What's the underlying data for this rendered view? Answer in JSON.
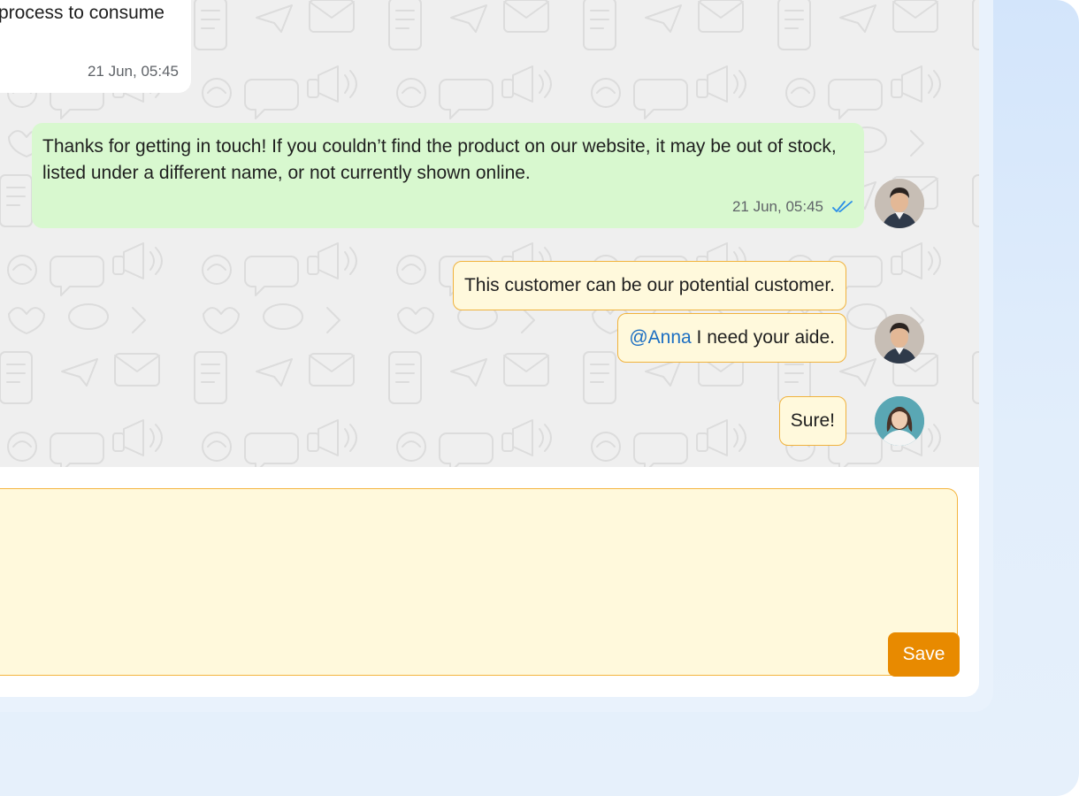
{
  "messages": {
    "incoming_fragment": {
      "text": "process to consume",
      "time": "21 Jun, 05:45"
    },
    "outgoing_reply": {
      "text": "Thanks for getting in touch! If you couldn’t find the product on our website, it may be out of stock, listed under a different name, or not currently shown online.",
      "time": "21 Jun, 05:45",
      "status_icon": "double-check-icon",
      "status_color": "#2a8ee8"
    },
    "internal_notes": [
      {
        "text": "This customer can be our potential customer."
      },
      {
        "mention": "@Anna",
        "text": " I need your aide."
      },
      {
        "text": "Sure!"
      }
    ]
  },
  "composer": {
    "save_label": "Save"
  },
  "colors": {
    "outgoing_bubble": "#d8f8cf",
    "note_bubble": "#fff9dc",
    "note_border": "#f0b23c",
    "save_button": "#e88a00",
    "mention": "#1b6ec2"
  }
}
